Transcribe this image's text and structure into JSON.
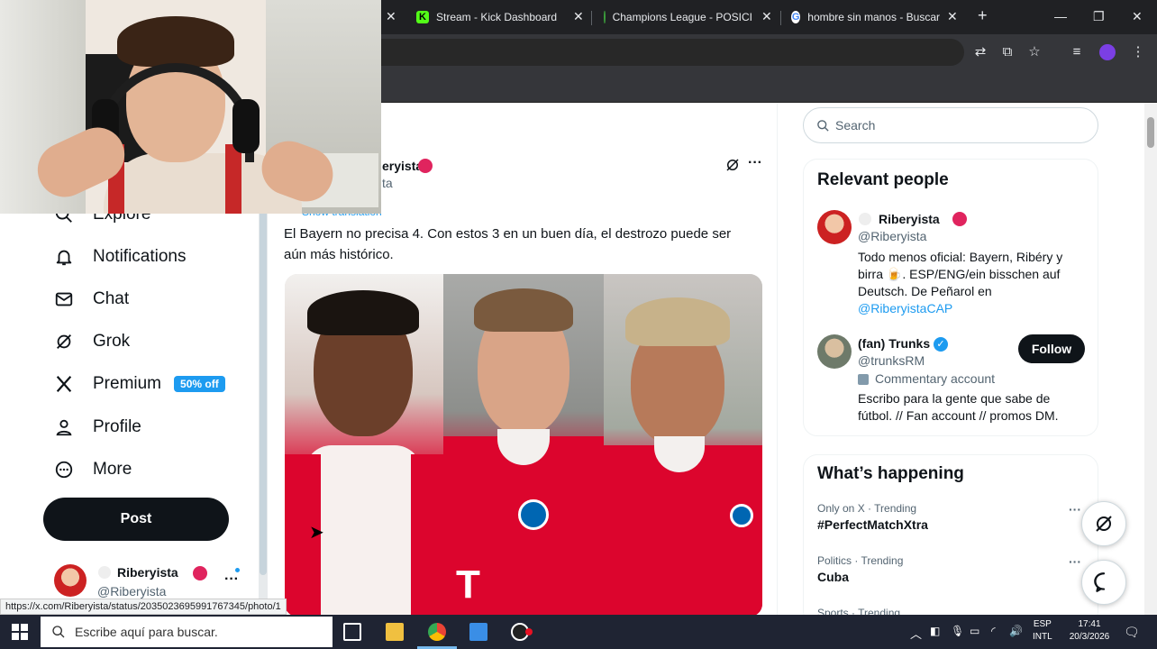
{
  "browser": {
    "tabs": [
      {
        "label": "Stream - Kick Dashboard",
        "color": "#53fc18"
      },
      {
        "label": "Champions League - POSICI",
        "color": "#3b9c3b"
      },
      {
        "label": "hombre sin manos - Buscar",
        "color": "#4285f4"
      }
    ],
    "new_tab": "+",
    "status_url": "https://x.com/Riberyista/status/2035023695991767345/photo/1"
  },
  "nav": {
    "explore": "Explore",
    "notifications": "Notifications",
    "chat": "Chat",
    "grok": "Grok",
    "premium": "Premium",
    "premium_badge": "50% off",
    "profile": "Profile",
    "more": "More",
    "post": "Post"
  },
  "account": {
    "name": "Riberyista",
    "handle": "@Riberyista"
  },
  "post": {
    "author_partial": "eryista",
    "handle_partial": "ta",
    "show_translation": "Show translation",
    "text": "El Bayern no precisa 4. Con estos 3 en un buen día, el destrozo puede ser aún más histórico."
  },
  "right": {
    "search_placeholder": "Search",
    "relevant_title": "Relevant people",
    "people": [
      {
        "name": "Riberyista",
        "handle": "@Riberyista",
        "bio": "Todo menos oficial: Bayern, Ribéry y birra 🍺. ESP/ENG/ein bisschen auf Deutsch. De Peñarol en",
        "bio_link": "@RiberyistaCAP"
      },
      {
        "name": "(fan) Trunks",
        "handle": "@trunksRM",
        "label": "Commentary account",
        "bio": "Escribo para la gente que sabe de fútbol. // Fan account // promos DM.",
        "follow": "Follow"
      }
    ],
    "happening_title": "What’s happening",
    "trends": [
      {
        "meta": "Only on X · Trending",
        "name": "#PerfectMatchXtra"
      },
      {
        "meta": "Politics · Trending",
        "name": "Cuba"
      },
      {
        "meta": "Sports · Trending",
        "name": ""
      }
    ]
  },
  "taskbar": {
    "search_placeholder": "Escribe aquí para buscar.",
    "lang1": "ESP",
    "lang2": "INTL",
    "time": "17:41",
    "date": "20/3/2026"
  },
  "colors": {
    "x_blue": "#1d9bf0",
    "verified_red": "#e0245e",
    "bayern_red": "#dc052d"
  }
}
